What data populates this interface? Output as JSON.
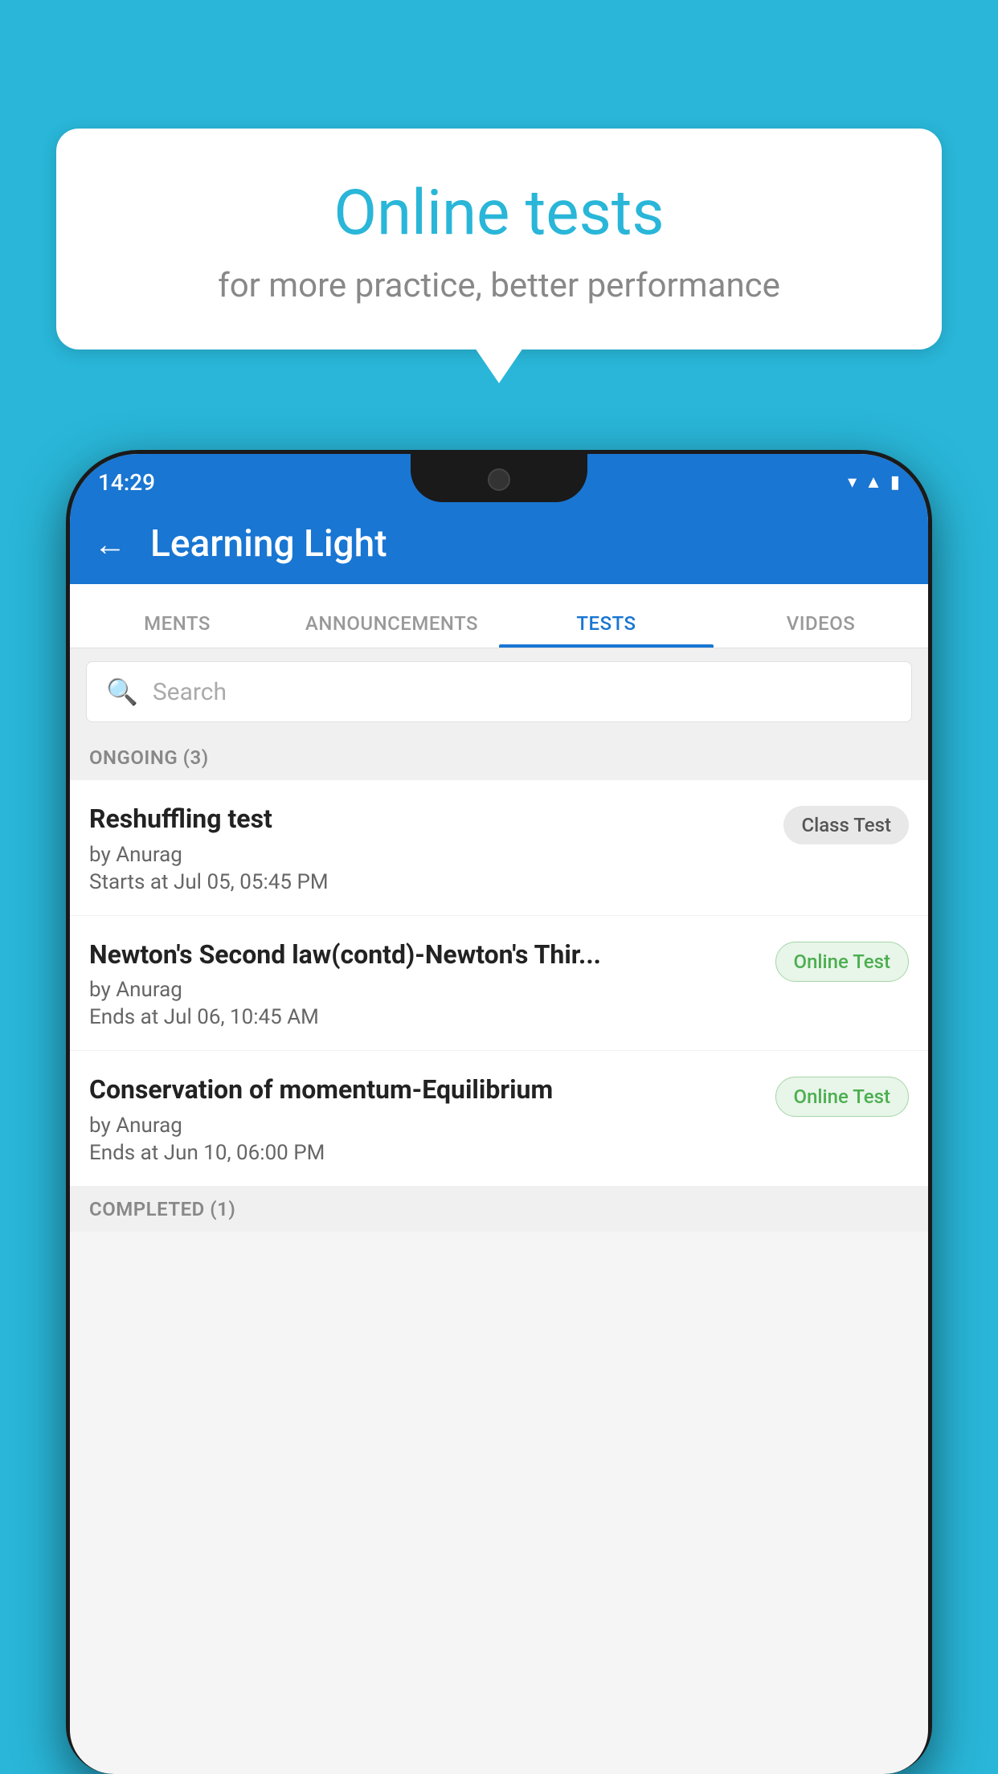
{
  "background": {
    "color": "#29B6D8"
  },
  "speech_bubble": {
    "title": "Online tests",
    "subtitle": "for more practice, better performance"
  },
  "status_bar": {
    "time": "14:29",
    "icons": [
      "wifi",
      "signal",
      "battery"
    ]
  },
  "app_bar": {
    "title": "Learning Light",
    "back_label": "←"
  },
  "tabs": [
    {
      "label": "MENTS",
      "active": false
    },
    {
      "label": "ANNOUNCEMENTS",
      "active": false
    },
    {
      "label": "TESTS",
      "active": true
    },
    {
      "label": "VIDEOS",
      "active": false
    }
  ],
  "search": {
    "placeholder": "Search"
  },
  "ongoing_section": {
    "label": "ONGOING (3)"
  },
  "tests": [
    {
      "title": "Reshuffling test",
      "author": "by Anurag",
      "time": "Starts at  Jul 05, 05:45 PM",
      "badge": "Class Test",
      "badge_type": "class"
    },
    {
      "title": "Newton's Second law(contd)-Newton's Thir...",
      "author": "by Anurag",
      "time": "Ends at  Jul 06, 10:45 AM",
      "badge": "Online Test",
      "badge_type": "online"
    },
    {
      "title": "Conservation of momentum-Equilibrium",
      "author": "by Anurag",
      "time": "Ends at  Jun 10, 06:00 PM",
      "badge": "Online Test",
      "badge_type": "online"
    }
  ],
  "completed_section": {
    "label": "COMPLETED (1)"
  }
}
